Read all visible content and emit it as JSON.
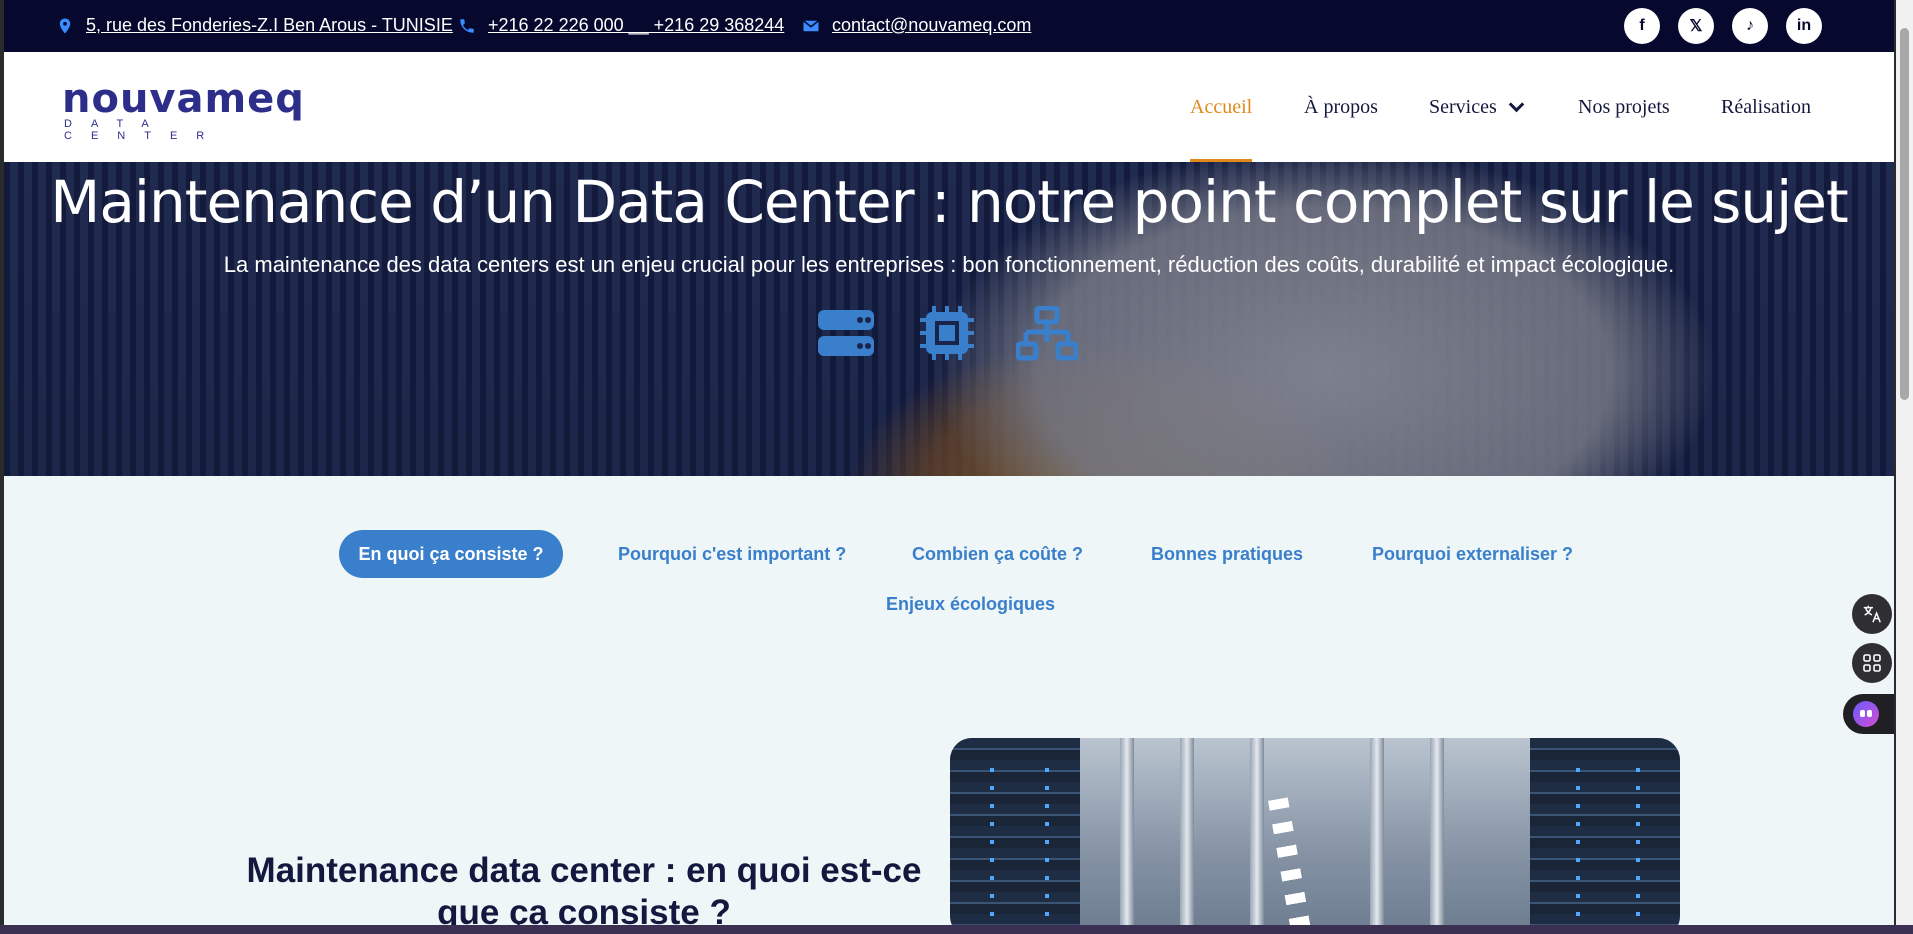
{
  "topbar": {
    "address": "5, rue des Fonderies-Z.I Ben Arous - TUNISIE",
    "phone": "+216 22 226 000 __ +216 29 368244",
    "email": "contact@nouvameq.com",
    "socials": [
      "facebook-icon",
      "twitter-icon",
      "tiktok-icon",
      "linkedin-icon"
    ],
    "social_glyphs": {
      "facebook": "f",
      "twitter": "𝕏",
      "tiktok": "♪",
      "linkedin": "in"
    }
  },
  "header": {
    "logo_main": "nouvameq",
    "logo_sub": "DATA CENTER",
    "nav": {
      "home": "Accueil",
      "about": "À propos",
      "services": "Services",
      "projects": "Nos projets",
      "realisation": "Réalisation"
    }
  },
  "hero": {
    "title": "Maintenance d’un Data Center : notre point complet sur le sujet",
    "subtitle": "La maintenance des data centers est un enjeu crucial pour les entreprises : bon fonctionnement, réduction des coûts, durabilité et impact écologique.",
    "icons": [
      "server-icon",
      "chip-icon",
      "network-icon"
    ]
  },
  "tabs": {
    "t1": "En quoi ça consiste ?",
    "t2": "Pourquoi c'est important ?",
    "t3": "Combien ça coûte ?",
    "t4": "Bonnes pratiques",
    "t5": "Pourquoi externaliser ?",
    "t6": "Enjeux écologiques"
  },
  "content": {
    "title": "Maintenance data center : en quoi est-ce que ça consiste ?"
  },
  "colors": {
    "topbar_bg": "#06092d",
    "accent_orange": "#e08a1e",
    "accent_blue": "#3a7fcb",
    "navy": "#13183e",
    "page_bg": "#eef6f7"
  }
}
